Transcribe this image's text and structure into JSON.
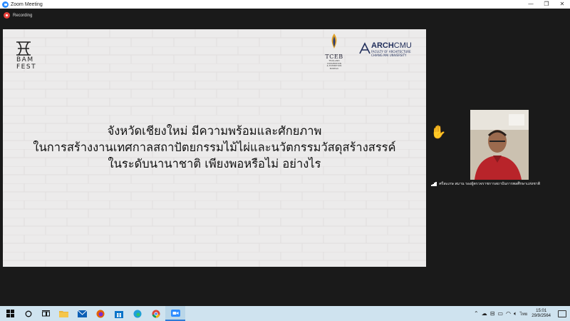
{
  "window": {
    "title": "Zoom Meeting",
    "minimize": "—",
    "maximize": "❐",
    "close": "✕"
  },
  "recording": {
    "label": "Recording"
  },
  "slide": {
    "logo_line1": "BAM",
    "logo_line2": "FEST",
    "tceb_name": "TCEB",
    "tceb_sub1": "THAILAND CONVENTION",
    "tceb_sub2": "& EXHIBITION BUREAU",
    "arch_bold": "ARCH",
    "arch_light": "CMU",
    "arch_sub1": "FACULTY OF ARCHITECTURE",
    "arch_sub2": "CHIANG MAI UNIVERSITY",
    "lines": [
      "จังหวัดเชียงใหม่ มีความพร้อมและศักยภาพ",
      "ในการสร้างงานเทศกาลสถาปัตยกรรมไม้ไผ่และนวัตกรรมวัสดุสร้างสรรค์",
      "ในระดับนานาชาติ เพียงพอหรือไม่ อย่างไร"
    ]
  },
  "reaction": "✋",
  "participant": {
    "name": "ศรีสะเกษ สมาน รองผู้ตรวจราชการสถาบันการพลศึกษาแห่งชาติ"
  },
  "taskbar": {
    "apps": [
      "windows-start",
      "cortana",
      "task-view",
      "file-explorer",
      "mail",
      "firefox",
      "store",
      "edge",
      "chrome",
      "zoom"
    ],
    "language": "ไทย",
    "time": "15:01",
    "date": "29/9/2564"
  }
}
